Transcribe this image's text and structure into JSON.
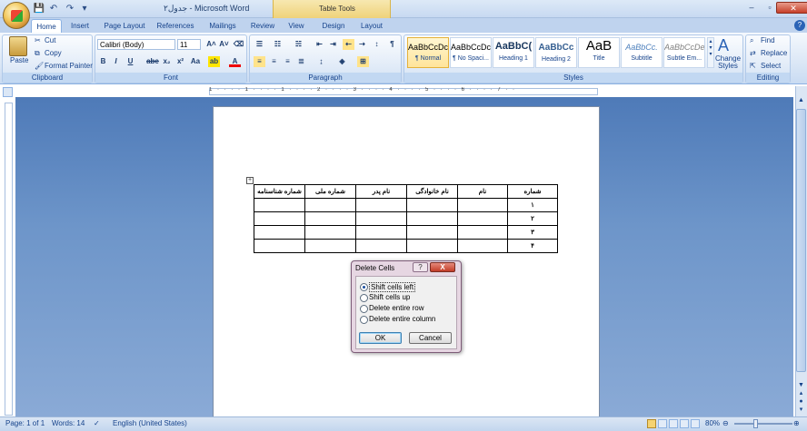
{
  "window": {
    "title": "جدول۲ - Microsoft Word",
    "context_tab": "Table Tools"
  },
  "tabs": [
    "Home",
    "Insert",
    "Page Layout",
    "References",
    "Mailings",
    "Review",
    "View",
    "Design",
    "Layout"
  ],
  "clipboard": {
    "paste": "Paste",
    "cut": "Cut",
    "copy": "Copy",
    "format_painter": "Format Painter",
    "label": "Clipboard"
  },
  "font": {
    "name": "Calibri (Body)",
    "size": "11",
    "label": "Font",
    "bold": "B",
    "italic": "I",
    "underline": "U",
    "strike": "abe",
    "subscript": "x₂",
    "superscript": "x²",
    "change_case": "Aa"
  },
  "paragraph": {
    "label": "Paragraph"
  },
  "styles": {
    "label": "Styles",
    "change_styles": "Change Styles",
    "items": [
      {
        "sample": "AaBbCcDc",
        "name": "¶ Normal"
      },
      {
        "sample": "AaBbCcDc",
        "name": "¶ No Spaci..."
      },
      {
        "sample": "AaBbC(",
        "name": "Heading 1"
      },
      {
        "sample": "AaBbCc",
        "name": "Heading 2"
      },
      {
        "sample": "AaB",
        "name": "Title"
      },
      {
        "sample": "AaBbCc.",
        "name": "Subtitle"
      },
      {
        "sample": "AaBbCcDe",
        "name": "Subtle Em..."
      }
    ]
  },
  "editing": {
    "label": "Editing",
    "find": "Find",
    "replace": "Replace",
    "select": "Select"
  },
  "ruler": {
    "marks": "1 · · · · 1 · · · · 1 · · · · 2 · · · · 3 · · · · 4 · · · · 5 · · · · 6 · · · · 7 · ·"
  },
  "table": {
    "header": [
      "شماره شناسنامه",
      "شماره ملی",
      "نام پدر",
      "نام خانوادگی",
      "نام",
      "شماره"
    ],
    "rows": [
      [
        "",
        "",
        "",
        "",
        "",
        "۱"
      ],
      [
        "",
        "",
        "",
        "",
        "",
        "۲"
      ],
      [
        "",
        "",
        "",
        "",
        "",
        "۳"
      ],
      [
        "",
        "",
        "",
        "",
        "",
        "۴"
      ]
    ]
  },
  "dialog": {
    "title": "Delete Cells",
    "help": "?",
    "close": "X",
    "options": [
      "Shift cells left",
      "Shift cells up",
      "Delete entire row",
      "Delete entire column"
    ],
    "selected": 0,
    "ok": "OK",
    "cancel": "Cancel"
  },
  "status": {
    "page": "Page: 1 of 1",
    "words": "Words: 14",
    "language": "English (United States)",
    "zoom": "80%"
  }
}
